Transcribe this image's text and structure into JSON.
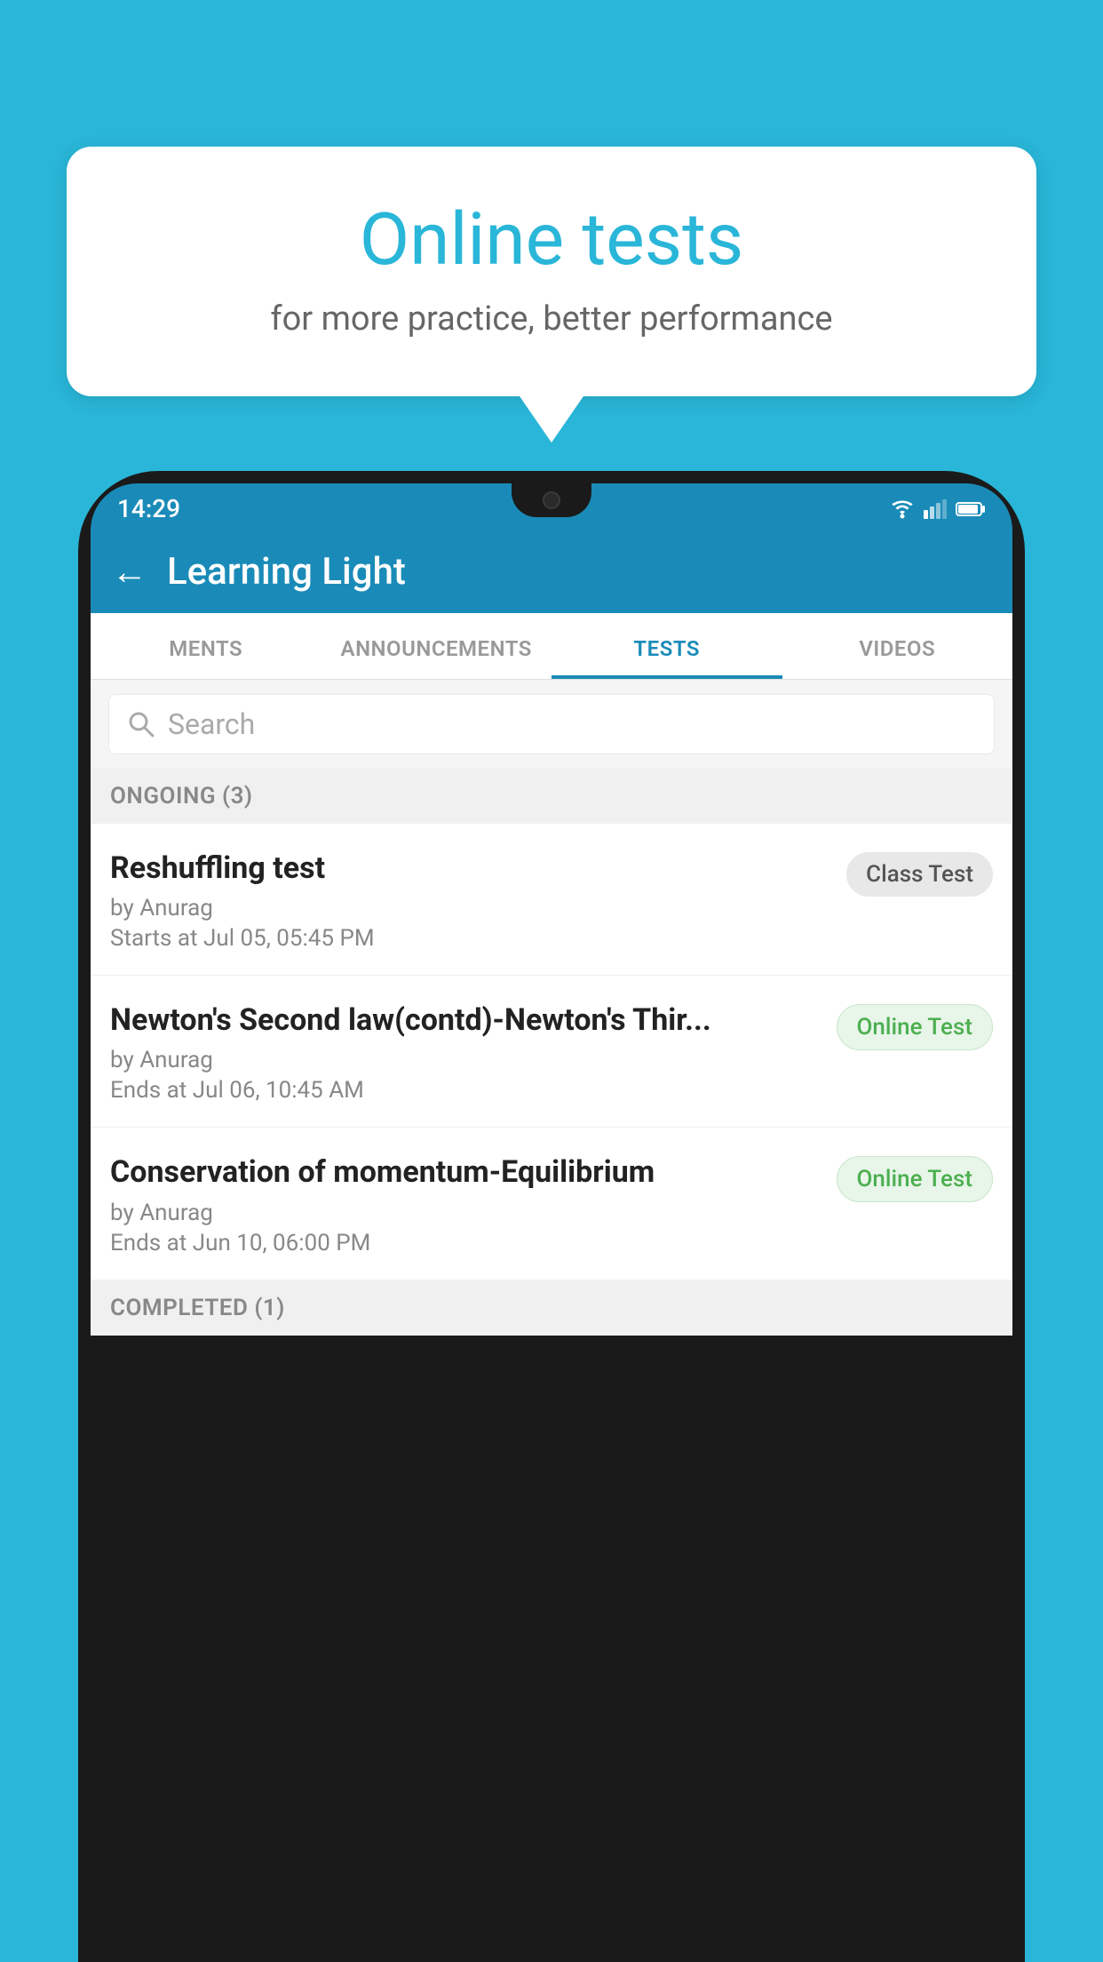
{
  "background": {
    "color": "#29b6d8"
  },
  "speech_bubble": {
    "title": "Online tests",
    "subtitle": "for more practice, better performance"
  },
  "phone": {
    "status_bar": {
      "time": "14:29",
      "icons": [
        "wifi",
        "signal",
        "battery"
      ]
    },
    "header": {
      "back_label": "←",
      "title": "Learning Light"
    },
    "tabs": [
      {
        "label": "MENTS",
        "active": false
      },
      {
        "label": "ANNOUNCEMENTS",
        "active": false
      },
      {
        "label": "TESTS",
        "active": true
      },
      {
        "label": "VIDEOS",
        "active": false
      }
    ],
    "search": {
      "placeholder": "Search"
    },
    "ongoing_section": {
      "title": "ONGOING (3)"
    },
    "tests": [
      {
        "name": "Reshuffling test",
        "by": "by Anurag",
        "time_label": "Starts at",
        "time": "Jul 05, 05:45 PM",
        "badge": "Class Test",
        "badge_type": "class"
      },
      {
        "name": "Newton's Second law(contd)-Newton's Thir...",
        "by": "by Anurag",
        "time_label": "Ends at",
        "time": "Jul 06, 10:45 AM",
        "badge": "Online Test",
        "badge_type": "online"
      },
      {
        "name": "Conservation of momentum-Equilibrium",
        "by": "by Anurag",
        "time_label": "Ends at",
        "time": "Jun 10, 06:00 PM",
        "badge": "Online Test",
        "badge_type": "online"
      }
    ],
    "completed_section": {
      "title": "COMPLETED (1)"
    }
  }
}
